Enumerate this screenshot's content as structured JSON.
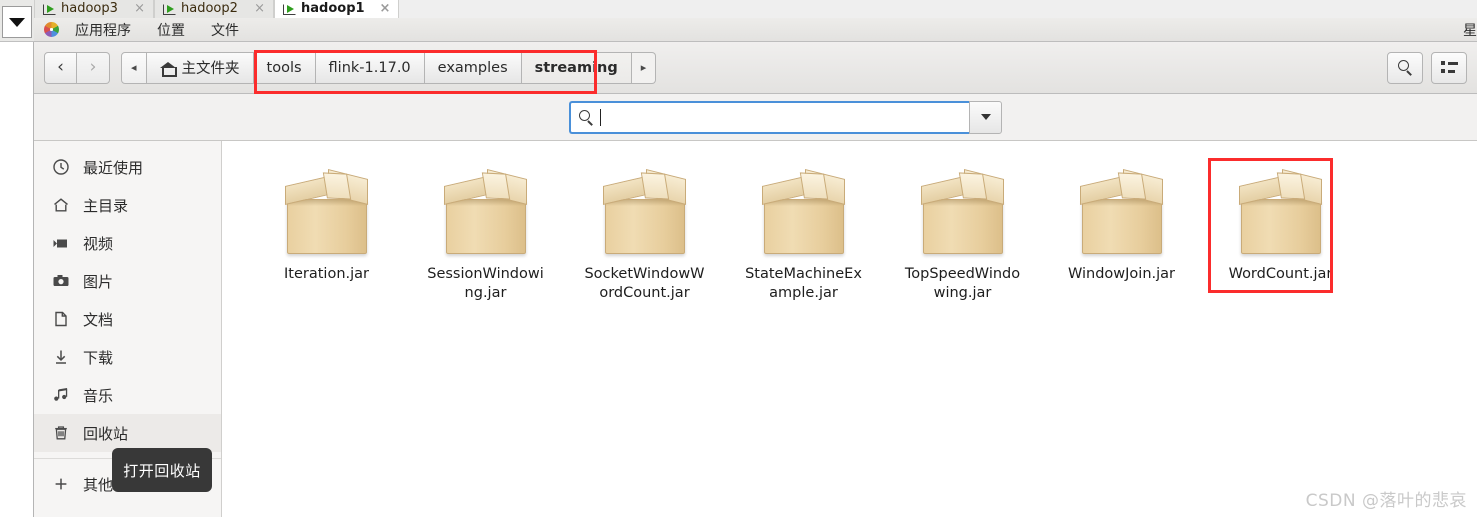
{
  "desktop": {
    "terminal_tabs": [
      {
        "label": "hadoop3",
        "active": false,
        "icon": "terminal-icon",
        "close": "×"
      },
      {
        "label": "hadoop2",
        "active": false,
        "icon": "terminal-icon",
        "close": "×"
      },
      {
        "label": "hadoop1",
        "active": true,
        "icon": "terminal-icon",
        "close": "×"
      }
    ],
    "menubar": {
      "logo": "gnome-footprint-icon",
      "items": [
        "应用程序",
        "位置",
        "文件"
      ],
      "clock": "星"
    },
    "left_dropdown": {
      "name": "dropdown-widget",
      "glyph": "▼"
    }
  },
  "filemanager": {
    "nav": {
      "back_label": "‹",
      "forward_label": "›",
      "path_prev_arrow": "◂",
      "path_next_arrow": "▸"
    },
    "breadcrumbs": [
      {
        "label": "主文件夹",
        "icon": "home-icon",
        "current": false
      },
      {
        "label": "tools",
        "current": false
      },
      {
        "label": "flink-1.17.0",
        "current": false
      },
      {
        "label": "examples",
        "current": false
      },
      {
        "label": "streaming",
        "current": true
      }
    ],
    "toolbar_right": [
      {
        "name": "search-button",
        "icon": "search-icon"
      },
      {
        "name": "view-options-button",
        "icon": "list-view-icon"
      }
    ],
    "search": {
      "value": "",
      "placeholder": "",
      "icon": "search-icon",
      "dropdown_glyph": "▼"
    },
    "sidebar": {
      "items": [
        {
          "label": "最近使用",
          "icon": "clock-icon",
          "hover": false
        },
        {
          "label": "主目录",
          "icon": "home-icon",
          "hover": false
        },
        {
          "label": "视频",
          "icon": "video-icon",
          "hover": false
        },
        {
          "label": "图片",
          "icon": "camera-icon",
          "hover": false
        },
        {
          "label": "文档",
          "icon": "document-icon",
          "hover": false
        },
        {
          "label": "下载",
          "icon": "download-icon",
          "hover": false
        },
        {
          "label": "音乐",
          "icon": "music-icon",
          "hover": false
        },
        {
          "label": "回收站",
          "icon": "trash-icon",
          "hover": true
        }
      ],
      "other_locations": {
        "label": "其他位置",
        "icon": "plus-icon"
      }
    },
    "tooltip": {
      "text": "打开回收站"
    },
    "files": [
      {
        "name": "Iteration.jar",
        "icon": "archive-box-icon",
        "selected": false
      },
      {
        "name": "SessionWindowing.jar",
        "icon": "archive-box-icon",
        "selected": false
      },
      {
        "name": "SocketWindowWordCount.jar",
        "icon": "archive-box-icon",
        "selected": false
      },
      {
        "name": "StateMachineExample.jar",
        "icon": "archive-box-icon",
        "selected": false
      },
      {
        "name": "TopSpeedWindowing.jar",
        "icon": "archive-box-icon",
        "selected": false
      },
      {
        "name": "WindowJoin.jar",
        "icon": "archive-box-icon",
        "selected": false
      },
      {
        "name": "WordCount.jar",
        "icon": "archive-box-icon",
        "selected": true
      }
    ]
  },
  "annotations": {
    "color": "#fb2c2c",
    "boxes": [
      {
        "name": "path-highlight",
        "target": "breadcrumbs"
      },
      {
        "name": "file-highlight",
        "target": "WordCount.jar"
      }
    ]
  },
  "watermark": {
    "text": "CSDN @落叶的悲哀"
  }
}
